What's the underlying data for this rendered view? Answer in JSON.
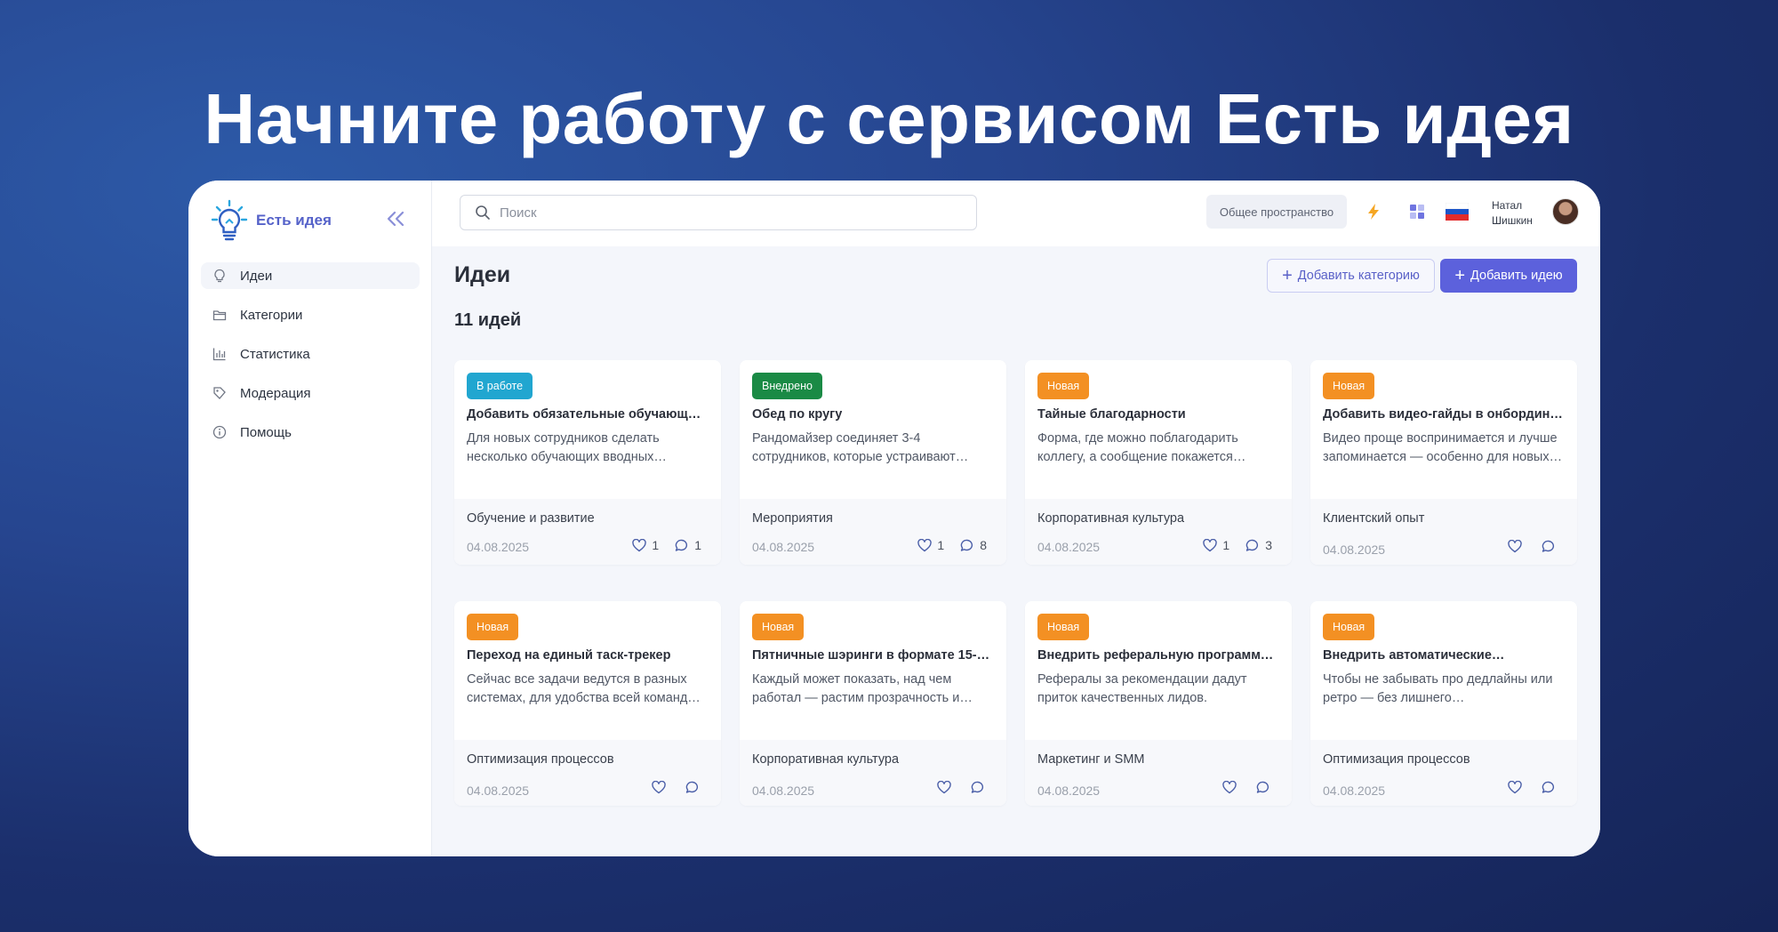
{
  "headline": "Начните работу с сервисом Есть идея",
  "brand": {
    "name": "Есть идея"
  },
  "sidebar": {
    "items": [
      {
        "label": "Идеи",
        "icon": "lightbulb-icon"
      },
      {
        "label": "Категории",
        "icon": "folder-icon"
      },
      {
        "label": "Статистика",
        "icon": "bar-chart-icon"
      },
      {
        "label": "Модерация",
        "icon": "tag-icon"
      },
      {
        "label": "Помощь",
        "icon": "info-icon"
      }
    ]
  },
  "topbar": {
    "search_placeholder": "Поиск",
    "space_label": "Общее пространство",
    "user_first": "Натал",
    "user_last": "Шишкин"
  },
  "page": {
    "title": "Идеи",
    "count": "11 идей",
    "add_category": "Добавить категорию",
    "add_idea": "Добавить идею"
  },
  "colors": {
    "accent": "#5c61dc",
    "status_work": "#21a6d0",
    "status_done": "#1a8a45",
    "status_new": "#f39023"
  },
  "cards": [
    {
      "status": "В работе",
      "title": "Добавить обязательные обучающие…",
      "desc": "Для новых сотрудников сделать несколько обучающих вводных…",
      "category": "Обучение и развитие",
      "date": "04.08.2025",
      "likes": "1",
      "comments": "1"
    },
    {
      "status": "Внедрено",
      "title": "Обед по кругу",
      "desc": "Рандомайзер соединяет 3-4 сотрудников, которые устраивают…",
      "category": "Мероприятия",
      "date": "04.08.2025",
      "likes": "1",
      "comments": "8"
    },
    {
      "status": "Новая",
      "title": "Тайные благодарности",
      "desc": "Форма, где можно поблагодарить коллегу, а сообщение покажется…",
      "category": "Корпоративная культура",
      "date": "04.08.2025",
      "likes": "1",
      "comments": "3"
    },
    {
      "status": "Новая",
      "title": "Добавить видео-гайды в онбординг…",
      "desc": "Видео проще воспринимается и лучше запоминается — особенно для новых…",
      "category": "Клиентский опыт",
      "date": "04.08.2025",
      "likes": "",
      "comments": ""
    },
    {
      "status": "Новая",
      "title": "Переход на единый таск-трекер",
      "desc": "Сейчас все задачи ведутся в разных системах, для удобства всей команд…",
      "category": "Оптимизация процессов",
      "date": "04.08.2025",
      "likes": "",
      "comments": ""
    },
    {
      "status": "Новая",
      "title": "Пятничные шэринги в формате 15-…",
      "desc": "Каждый может показать, над чем работал — растим прозрачность и…",
      "category": "Корпоративная культура",
      "date": "04.08.2025",
      "likes": "",
      "comments": ""
    },
    {
      "status": "Новая",
      "title": "Внедрить реферальную программу…",
      "desc": "Рефералы за рекомендации дадут приток качественных лидов.",
      "category": "Маркетинг и SMM",
      "date": "04.08.2025",
      "likes": "",
      "comments": ""
    },
    {
      "status": "Новая",
      "title": "Внедрить автоматические…",
      "desc": "Чтобы не забывать про дедлайны или ретро — без лишнего…",
      "category": "Оптимизация процессов",
      "date": "04.08.2025",
      "likes": "",
      "comments": ""
    }
  ]
}
